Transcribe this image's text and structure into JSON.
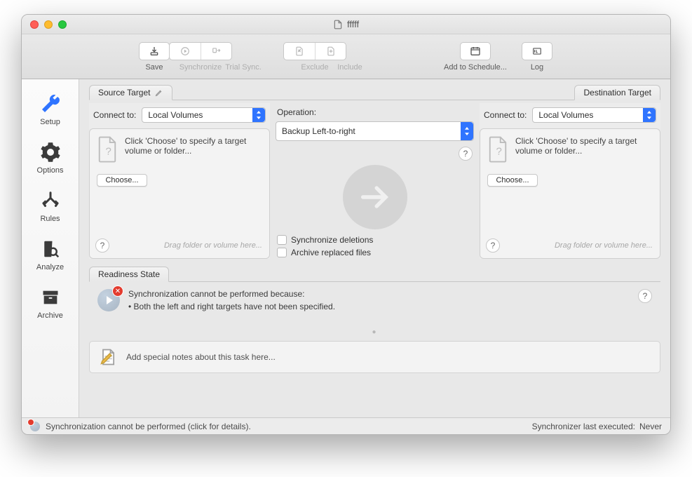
{
  "title": "fffff",
  "toolbar": {
    "save": "Save",
    "synchronize": "Synchronize",
    "trial_sync": "Trial Sync.",
    "exclude": "Exclude",
    "include": "Include",
    "add_schedule": "Add to Schedule...",
    "log": "Log"
  },
  "sidebar": {
    "setup": "Setup",
    "options": "Options",
    "rules": "Rules",
    "analyze": "Analyze",
    "archive": "Archive"
  },
  "tabs": {
    "source": "Source Target",
    "destination": "Destination Target",
    "readiness": "Readiness State"
  },
  "source": {
    "connect_label": "Connect to:",
    "connect_value": "Local Volumes",
    "drop_text": "Click 'Choose' to specify a target volume or folder...",
    "choose": "Choose...",
    "hint": "Drag folder or volume here..."
  },
  "center": {
    "operation_label": "Operation:",
    "operation_value": "Backup Left-to-right",
    "sync_deletions": "Synchronize deletions",
    "archive_replaced": "Archive replaced files"
  },
  "destination": {
    "connect_label": "Connect to:",
    "connect_value": "Local Volumes",
    "drop_text": "Click 'Choose' to specify a target volume or folder...",
    "choose": "Choose...",
    "hint": "Drag folder or volume here..."
  },
  "readiness": {
    "line1": "Synchronization cannot be performed because:",
    "line2": "• Both the left and right targets have not been specified."
  },
  "notes": {
    "placeholder": "Add special notes about this task here..."
  },
  "status": {
    "left": "Synchronization cannot be performed (click for details).",
    "right_label": "Synchronizer last executed:",
    "right_value": "Never"
  },
  "glyphs": {
    "help": "?",
    "err": "✕"
  }
}
